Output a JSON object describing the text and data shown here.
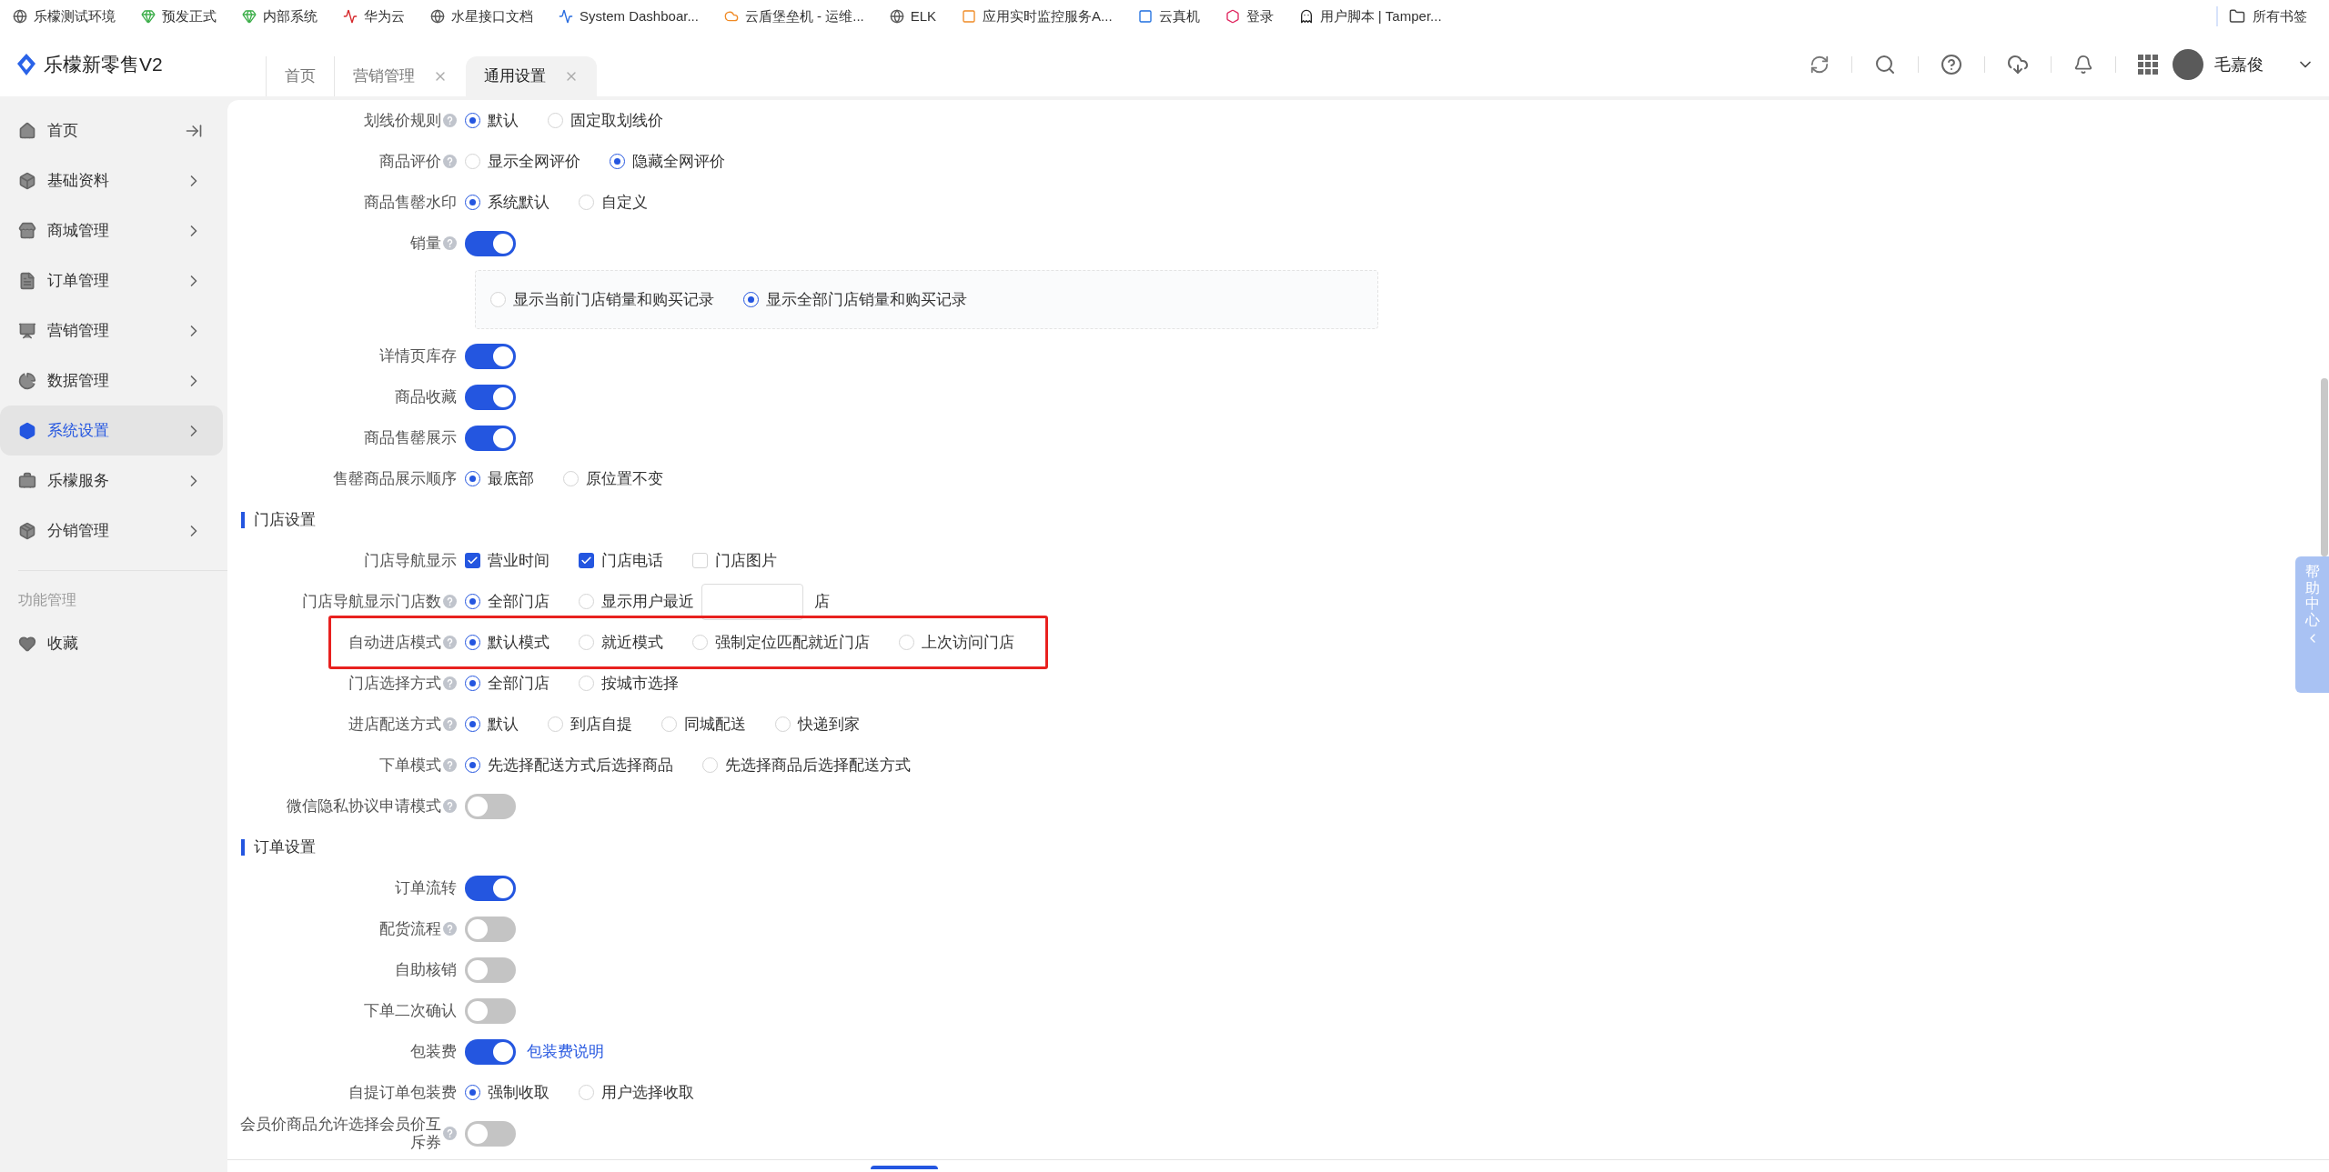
{
  "bookmarks": [
    {
      "label": "乐檬测试环境"
    },
    {
      "label": "预发正式"
    },
    {
      "label": "内部系统"
    },
    {
      "label": "华为云"
    },
    {
      "label": "水星接口文档"
    },
    {
      "label": "System Dashboar..."
    },
    {
      "label": "云盾堡垒机 - 运维..."
    },
    {
      "label": "ELK"
    },
    {
      "label": "应用实时监控服务A..."
    },
    {
      "label": "云真机"
    },
    {
      "label": "登录"
    },
    {
      "label": "用户脚本 | Tamper..."
    }
  ],
  "all_bookmarks": "所有书签",
  "app": {
    "title": "乐檬新零售V2"
  },
  "tabs": [
    {
      "label": "首页",
      "selected": false,
      "closable": false
    },
    {
      "label": "营销管理",
      "selected": false,
      "closable": true
    },
    {
      "label": "通用设置",
      "selected": true,
      "closable": true
    }
  ],
  "user": {
    "name": "毛嘉俊"
  },
  "sidebar": {
    "items": [
      {
        "label": "首页",
        "selected": false
      },
      {
        "label": "基础资料",
        "selected": false
      },
      {
        "label": "商城管理",
        "selected": false
      },
      {
        "label": "订单管理",
        "selected": false
      },
      {
        "label": "营销管理",
        "selected": false
      },
      {
        "label": "数据管理",
        "selected": false
      },
      {
        "label": "系统设置",
        "selected": true
      },
      {
        "label": "乐檬服务",
        "selected": false
      },
      {
        "label": "分销管理",
        "selected": false
      }
    ],
    "section_title": "功能管理",
    "extra_items": [
      {
        "label": "收藏",
        "selected": false
      }
    ]
  },
  "help_tab": {
    "label": "帮助中心"
  },
  "groups": [
    {
      "rows": [
        {
          "kind": "radio",
          "label": "划线价规则",
          "help": true,
          "options": [
            {
              "label": "默认",
              "selected": true
            },
            {
              "label": "固定取划线价",
              "selected": false
            }
          ]
        },
        {
          "kind": "radio",
          "label": "商品评价",
          "help": true,
          "options": [
            {
              "label": "显示全网评价",
              "selected": false
            },
            {
              "label": "隐藏全网评价",
              "selected": true
            }
          ]
        },
        {
          "kind": "radio",
          "label": "商品售罄水印",
          "help": false,
          "options": [
            {
              "label": "系统默认",
              "selected": true
            },
            {
              "label": "自定义",
              "selected": false
            }
          ]
        },
        {
          "kind": "toggle",
          "label": "销量",
          "help": true,
          "on": true,
          "sub_options": [
            {
              "label": "显示当前门店销量和购买记录",
              "selected": false
            },
            {
              "label": "显示全部门店销量和购买记录",
              "selected": true
            }
          ]
        },
        {
          "kind": "toggle",
          "label": "详情页库存",
          "help": false,
          "on": true
        },
        {
          "kind": "toggle",
          "label": "商品收藏",
          "help": false,
          "on": true
        },
        {
          "kind": "toggle",
          "label": "商品售罄展示",
          "help": false,
          "on": true
        },
        {
          "kind": "radio",
          "label": "售罄商品展示顺序",
          "help": false,
          "options": [
            {
              "label": "最底部",
              "selected": true
            },
            {
              "label": "原位置不变",
              "selected": false
            }
          ]
        }
      ]
    },
    {
      "title": "门店设置",
      "rows": [
        {
          "kind": "checkbox",
          "label": "门店导航显示",
          "help": false,
          "options": [
            {
              "label": "营业时间",
              "checked": true
            },
            {
              "label": "门店电话",
              "checked": true
            },
            {
              "label": "门店图片",
              "checked": false
            }
          ]
        },
        {
          "kind": "radio_input",
          "label": "门店导航显示门店数",
          "help": true,
          "options": [
            {
              "label": "全部门店",
              "selected": true
            },
            {
              "label": "显示用户最近",
              "selected": false
            }
          ],
          "suffix": "店"
        },
        {
          "kind": "radio",
          "label": "自动进店模式",
          "help": true,
          "highlighted": true,
          "options": [
            {
              "label": "默认模式",
              "selected": true
            },
            {
              "label": "就近模式",
              "selected": false
            },
            {
              "label": "强制定位匹配就近门店",
              "selected": false
            },
            {
              "label": "上次访问门店",
              "selected": false
            }
          ]
        },
        {
          "kind": "radio",
          "label": "门店选择方式",
          "help": true,
          "options": [
            {
              "label": "全部门店",
              "selected": true
            },
            {
              "label": "按城市选择",
              "selected": false
            }
          ]
        },
        {
          "kind": "radio",
          "label": "进店配送方式",
          "help": true,
          "options": [
            {
              "label": "默认",
              "selected": true
            },
            {
              "label": "到店自提",
              "selected": false
            },
            {
              "label": "同城配送",
              "selected": false
            },
            {
              "label": "快递到家",
              "selected": false
            }
          ]
        },
        {
          "kind": "radio",
          "label": "下单模式",
          "help": true,
          "options": [
            {
              "label": "先选择配送方式后选择商品",
              "selected": true
            },
            {
              "label": "先选择商品后选择配送方式",
              "selected": false
            }
          ]
        },
        {
          "kind": "toggle",
          "label": "微信隐私协议申请模式",
          "help": true,
          "on": false
        }
      ]
    },
    {
      "title": "订单设置",
      "rows": [
        {
          "kind": "toggle",
          "label": "订单流转",
          "help": false,
          "on": true
        },
        {
          "kind": "toggle",
          "label": "配货流程",
          "help": true,
          "on": false
        },
        {
          "kind": "toggle",
          "label": "自助核销",
          "help": false,
          "on": false
        },
        {
          "kind": "toggle",
          "label": "下单二次确认",
          "help": false,
          "on": false
        },
        {
          "kind": "toggle",
          "label": "包装费",
          "help": false,
          "on": true,
          "link": "包装费说明"
        },
        {
          "kind": "radio",
          "label": "自提订单包装费",
          "help": false,
          "options": [
            {
              "label": "强制收取",
              "selected": true
            },
            {
              "label": "用户选择收取",
              "selected": false
            }
          ]
        },
        {
          "kind": "toggle",
          "label": "会员价商品允许选择会员价互斥券",
          "help": true,
          "on": false
        }
      ]
    }
  ]
}
